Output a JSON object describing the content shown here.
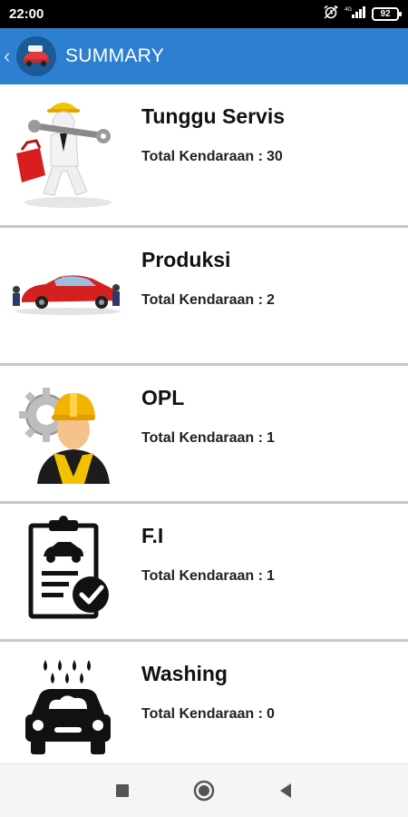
{
  "status_bar": {
    "time": "22:00",
    "battery_level": "92",
    "icons": [
      "alarm-icon",
      "signal-icon",
      "battery-icon"
    ]
  },
  "app_bar": {
    "title": "SUMMARY",
    "background": "#2d7fcf"
  },
  "list": {
    "items": [
      {
        "title": "Tunggu Servis",
        "count_label": "Total Kendaraan :",
        "count": "30",
        "icon": "mechanic-wrench-icon"
      },
      {
        "title": "Produksi",
        "count_label": "Total Kendaraan :",
        "count": "2",
        "icon": "car-repair-icon"
      },
      {
        "title": "OPL",
        "count_label": "Total Kendaraan :",
        "count": "1",
        "icon": "worker-gear-icon"
      },
      {
        "title": "F.I",
        "count_label": "Total Kendaraan :",
        "count": "1",
        "icon": "clipboard-check-icon"
      },
      {
        "title": "Washing",
        "count_label": "Total Kendaraan :",
        "count": "0",
        "icon": "car-wash-icon"
      }
    ]
  },
  "nav_bar": {
    "buttons": [
      "recents-button",
      "home-button",
      "back-button"
    ]
  }
}
